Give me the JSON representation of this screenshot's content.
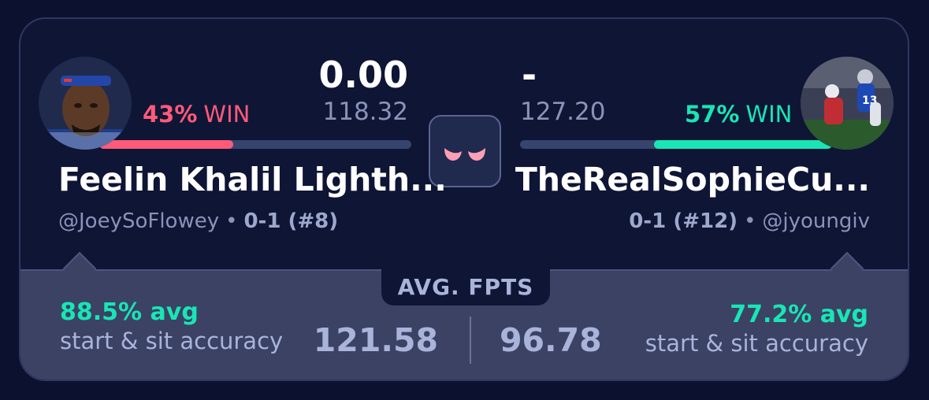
{
  "matchup": {
    "left": {
      "score": "0.00",
      "projected": "118.32",
      "win_pct": "43%",
      "win_label": "WIN",
      "win_fraction": 0.43,
      "team_name": "Feelin Khalil Lighth...",
      "handle": "@JoeySoFlowey",
      "record": "0-1 (#8)",
      "avatar_icon": "player-helmet-headband-avatar",
      "accuracy_pct": "88.5% avg",
      "accuracy_label": "start & sit accuracy",
      "avg_fpts": "121.58"
    },
    "right": {
      "score": "-",
      "projected": "127.20",
      "win_pct": "57%",
      "win_label": "WIN",
      "win_fraction": 0.57,
      "team_name": "TheRealSophieCu...",
      "handle": "@jyoungiv",
      "record": "0-1 (#12)",
      "avatar_icon": "football-action-avatar",
      "accuracy_pct": "77.2% avg",
      "accuracy_label": "start & sit accuracy",
      "avg_fpts": "96.78"
    },
    "vs_icon": "angry-eyes-icon",
    "avg_header": "AVG. FPTS",
    "separator": "•"
  },
  "colors": {
    "left_accent": "#ff5a7a",
    "right_accent": "#18e6b5",
    "card_bg": "#0f1535",
    "panel_bg": "#3b4264"
  }
}
